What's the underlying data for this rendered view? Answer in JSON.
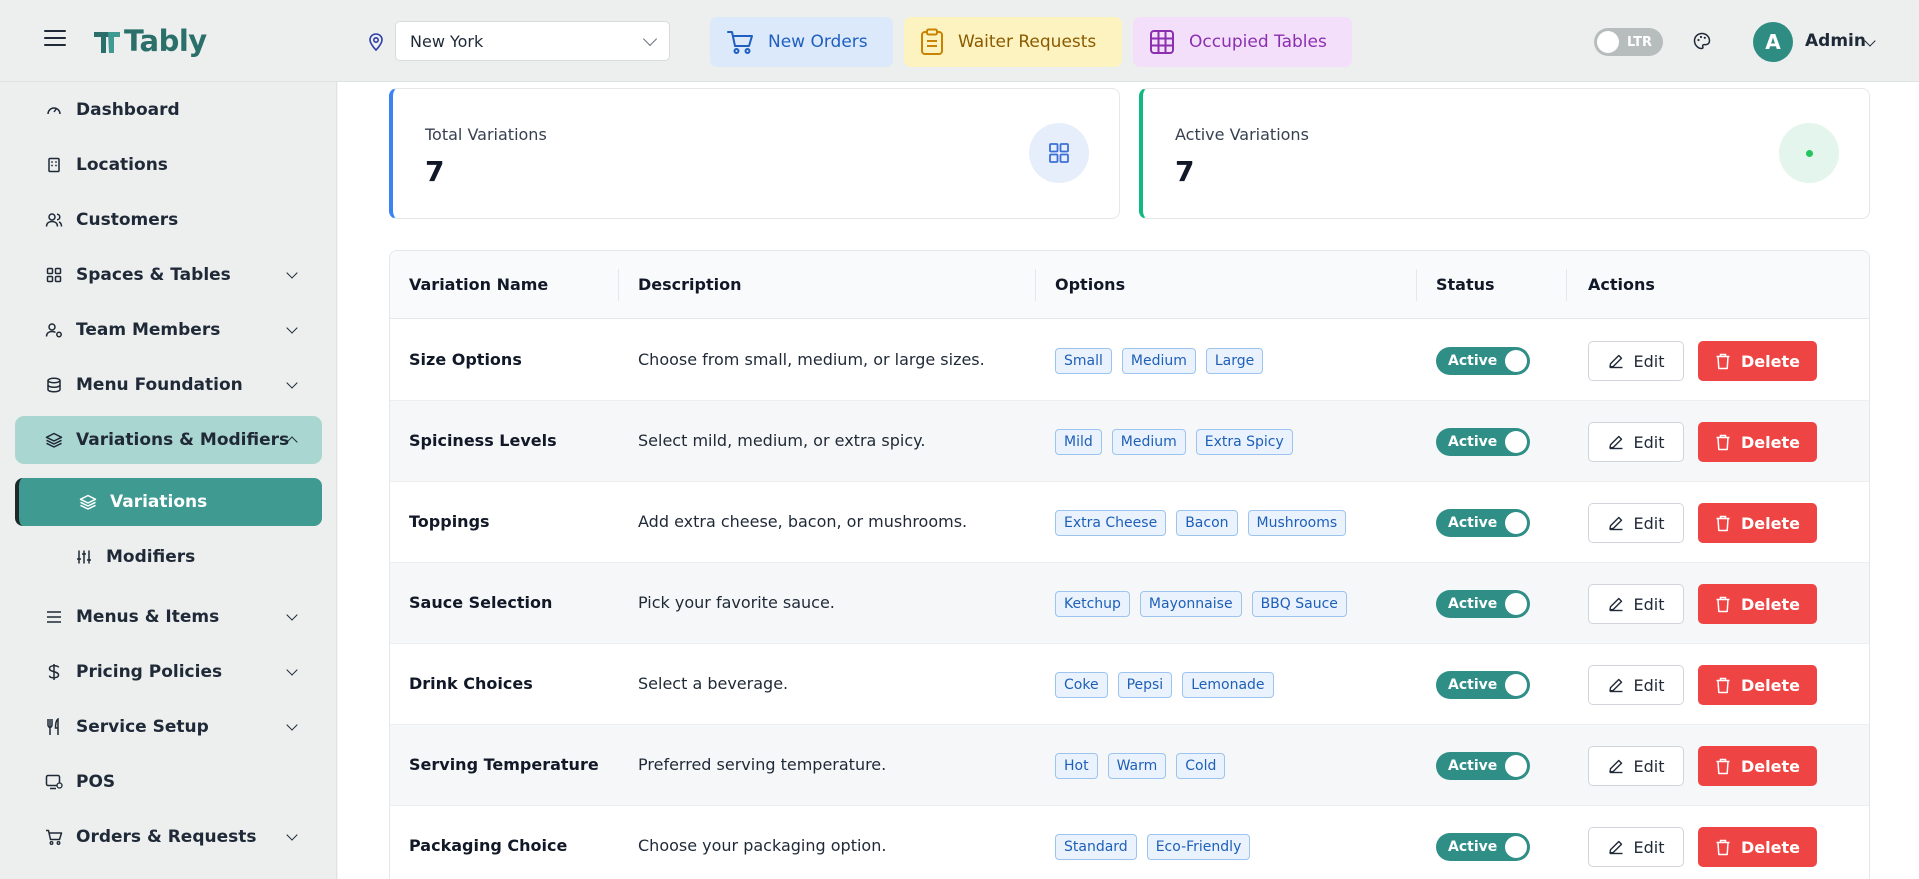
{
  "brand": {
    "name": "Tably"
  },
  "topbar": {
    "location": "New York",
    "quick": [
      {
        "label": "New Orders"
      },
      {
        "label": "Waiter Requests"
      },
      {
        "label": "Occupied Tables"
      }
    ],
    "direction_toggle": "LTR",
    "avatar_initial": "A",
    "user_name": "Admin"
  },
  "sidebar": {
    "items": [
      {
        "label": "Dashboard"
      },
      {
        "label": "Locations"
      },
      {
        "label": "Customers"
      },
      {
        "label": "Spaces & Tables"
      },
      {
        "label": "Team Members"
      },
      {
        "label": "Menu Foundation"
      },
      {
        "label": "Variations & Modifiers"
      },
      {
        "label": "Variations"
      },
      {
        "label": "Modifiers"
      },
      {
        "label": "Menus & Items"
      },
      {
        "label": "Pricing Policies"
      },
      {
        "label": "Service Setup"
      },
      {
        "label": "POS"
      },
      {
        "label": "Orders & Requests"
      }
    ]
  },
  "stats": {
    "total": {
      "label": "Total Variations",
      "value": "7"
    },
    "active": {
      "label": "Active Variations",
      "value": "7"
    }
  },
  "table": {
    "headers": [
      "Variation Name",
      "Description",
      "Options",
      "Status",
      "Actions"
    ],
    "edit_label": "Edit",
    "delete_label": "Delete",
    "rows": [
      {
        "name": "Size Options",
        "description": "Choose from small, medium, or large sizes.",
        "options": [
          "Small",
          "Medium",
          "Large"
        ],
        "status": "Active"
      },
      {
        "name": "Spiciness Levels",
        "description": "Select mild, medium, or extra spicy.",
        "options": [
          "Mild",
          "Medium",
          "Extra Spicy"
        ],
        "status": "Active"
      },
      {
        "name": "Toppings",
        "description": "Add extra cheese, bacon, or mushrooms.",
        "options": [
          "Extra Cheese",
          "Bacon",
          "Mushrooms"
        ],
        "status": "Active"
      },
      {
        "name": "Sauce Selection",
        "description": "Pick your favorite sauce.",
        "options": [
          "Ketchup",
          "Mayonnaise",
          "BBQ Sauce"
        ],
        "status": "Active"
      },
      {
        "name": "Drink Choices",
        "description": "Select a beverage.",
        "options": [
          "Coke",
          "Pepsi",
          "Lemonade"
        ],
        "status": "Active"
      },
      {
        "name": "Serving Temperature",
        "description": "Preferred serving temperature.",
        "options": [
          "Hot",
          "Warm",
          "Cold"
        ],
        "status": "Active"
      },
      {
        "name": "Packaging Choice",
        "description": "Choose your packaging option.",
        "options": [
          "Standard",
          "Eco-Friendly"
        ],
        "status": "Active"
      }
    ]
  }
}
